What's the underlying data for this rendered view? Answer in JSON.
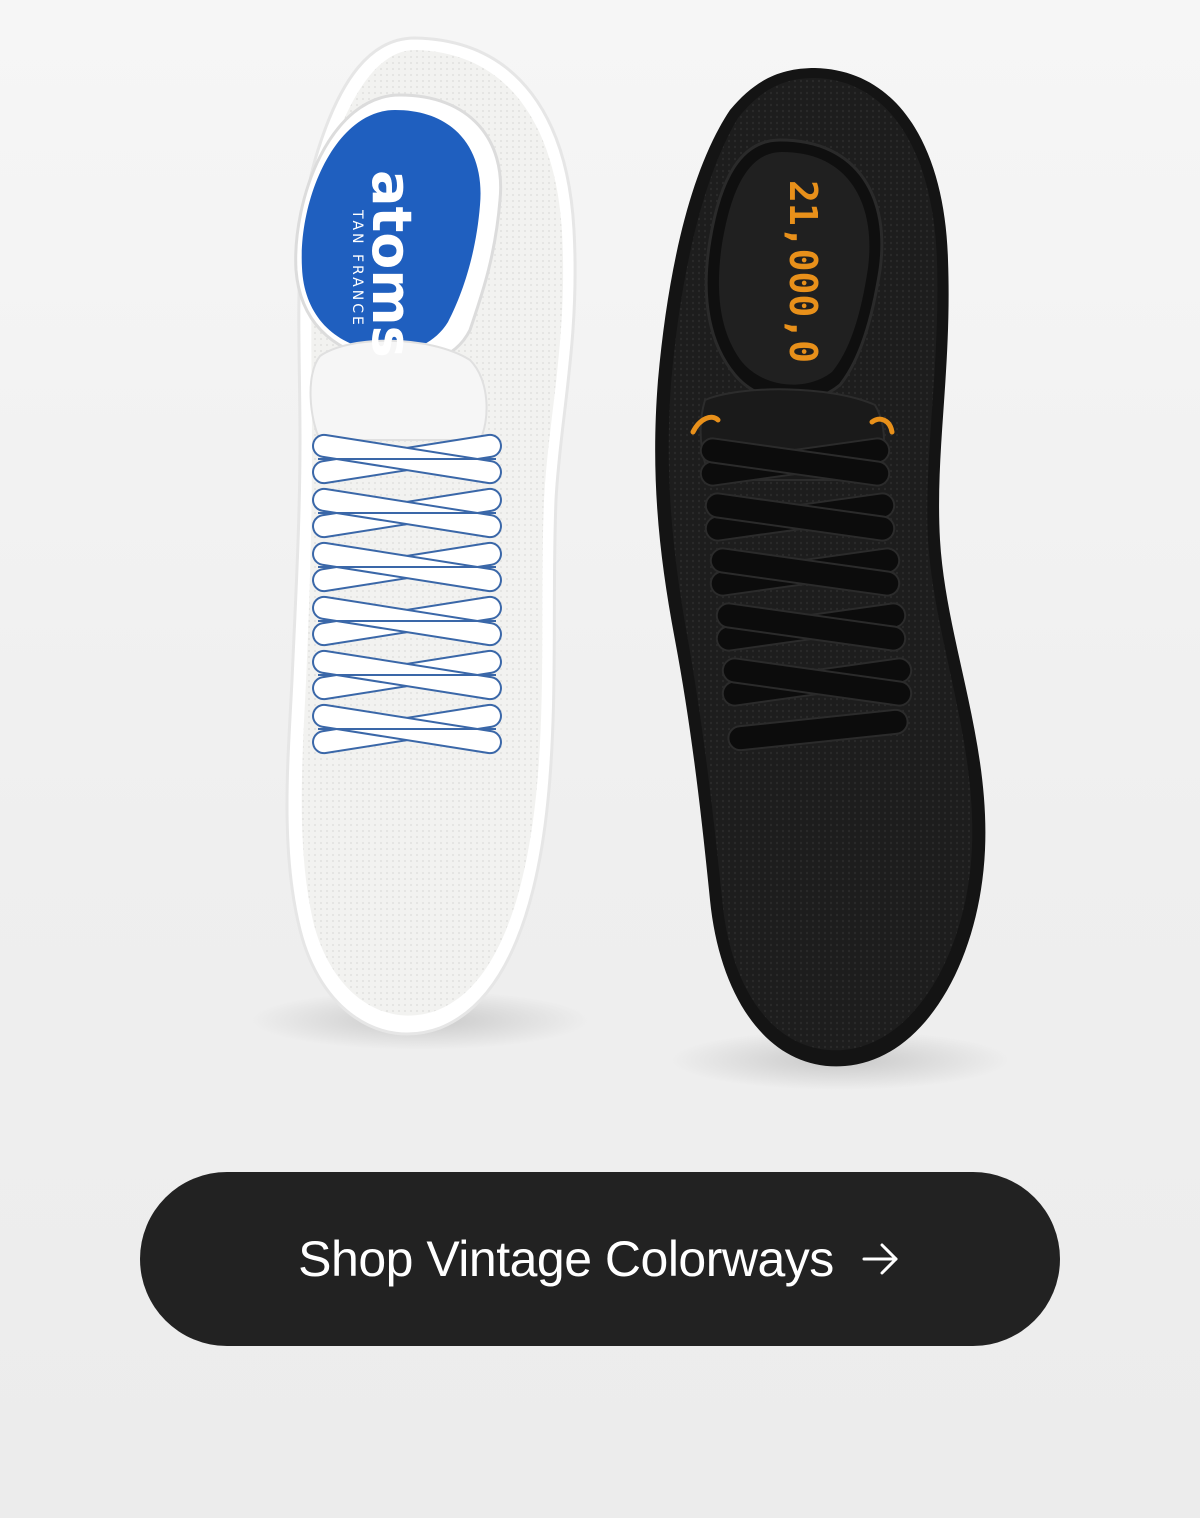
{
  "colors": {
    "cta_background": "#222222",
    "cta_text": "#ffffff",
    "white_shoe": "#f3f3f1",
    "black_shoe": "#1c1c1c",
    "insole_blue": "#1f5fbf",
    "lace_blue": "#3a67a8",
    "accent_orange": "#e8901a"
  },
  "products": {
    "white_shoe": {
      "insole_brand": "atoms",
      "insole_subtitle": "TAN FRANCE"
    },
    "black_shoe": {
      "insole_print": "21,000,0"
    }
  },
  "cta": {
    "label": "Shop Vintage Colorways",
    "icon": "arrow-right-icon"
  }
}
